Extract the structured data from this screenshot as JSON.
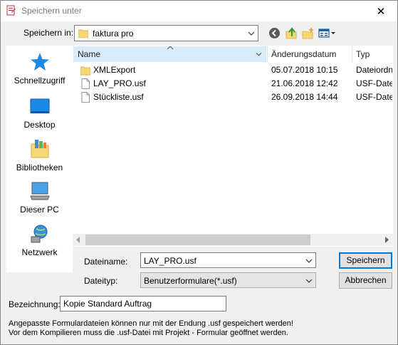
{
  "window": {
    "title": "Speichern unter",
    "close_glyph": "✕"
  },
  "lookin": {
    "label": "Speichern in:",
    "value": "faktura pro"
  },
  "toolbar": {
    "icons": [
      "back-icon",
      "up-folder-icon",
      "new-folder-icon",
      "view-menu-icon"
    ]
  },
  "places": [
    {
      "label": "Schnellzugriff",
      "icon": "quick-access-star-icon"
    },
    {
      "label": "Desktop",
      "icon": "desktop-icon"
    },
    {
      "label": "Bibliotheken",
      "icon": "libraries-icon"
    },
    {
      "label": "Dieser PC",
      "icon": "this-pc-icon"
    },
    {
      "label": "Netzwerk",
      "icon": "network-icon"
    }
  ],
  "filelist": {
    "columns": [
      "Name",
      "Änderungsdatum",
      "Typ"
    ],
    "sort_indicator": "^",
    "rows": [
      {
        "name": "XMLExport",
        "date": "05.07.2018 10:15",
        "type": "Dateiordn",
        "icon": "folder-icon"
      },
      {
        "name": "LAY_PRO.usf",
        "date": "21.06.2018 12:42",
        "type": "USF-Datei",
        "icon": "file-icon"
      },
      {
        "name": "Stückliste.usf",
        "date": "26.09.2018 14:44",
        "type": "USF-Datei",
        "icon": "file-icon"
      }
    ]
  },
  "form": {
    "filename_label": "Dateiname:",
    "filename_value": "LAY_PRO.usf",
    "filetype_label": "Dateityp:",
    "filetype_value": "Benutzerformulare(*.usf)",
    "save_label": "Speichern",
    "cancel_label": "Abbrechen",
    "description_label": "Bezeichnung:",
    "description_value": "Kopie Standard Auftrag"
  },
  "info": {
    "line1": "Angepasste Formulardateien können nur mit der Endung .usf gespeichert werden!",
    "line2": "Vor dem Kompilieren muss die .usf-Datei mit Projekt - Formular geöffnet werden."
  },
  "colors": {
    "accent": "#0078d7",
    "sorted_header": "#d9ebf9",
    "folder": "#f8d775"
  }
}
